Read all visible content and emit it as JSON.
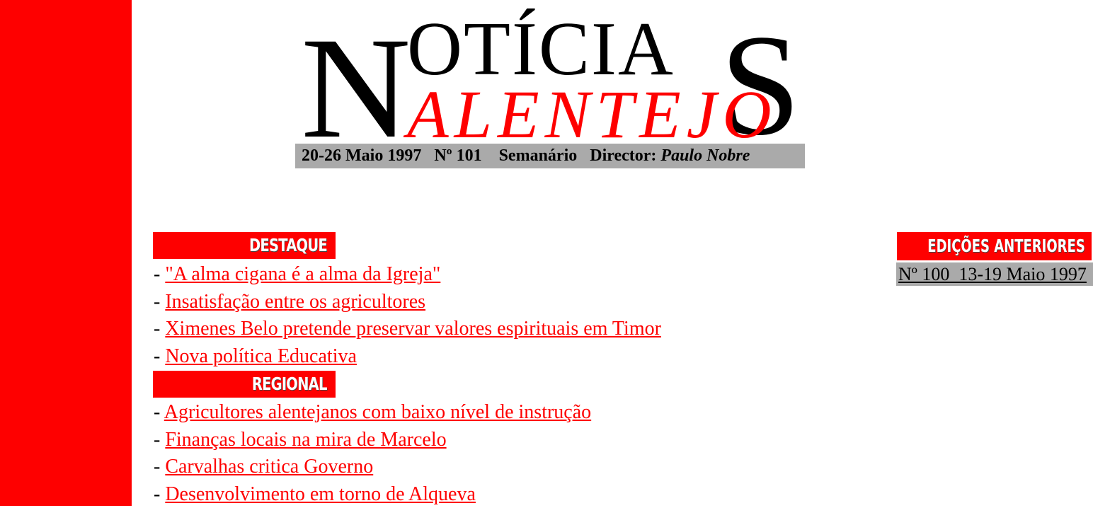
{
  "masthead": {
    "logo_n": "N",
    "logo_otici": "OTÍCIA",
    "logo_s": "S",
    "logo_sub": "ALENTEJO",
    "date": "20-26 Maio 1997",
    "number": "Nº 101",
    "type": "Semanário",
    "director_label": "Director:",
    "director_name": "Paulo Nobre"
  },
  "sections": [
    {
      "title": "DESTAQUE",
      "items": [
        "\"A alma cigana é a alma da Igreja\"",
        "Insatisfação entre os agricultores",
        "Ximenes Belo pretende preservar valores espirituais em Timor",
        "Nova política Educativa"
      ]
    },
    {
      "title": "REGIONAL",
      "items": [
        "Agricultores alentejanos com baixo nível de instrução",
        "Finanças locais na mira de Marcelo",
        "Carvalhas critica Governo",
        "Desenvolvimento em torno de Alqueva"
      ]
    }
  ],
  "previous_editions": {
    "title": "EDIÇÕES ANTERIORES",
    "link": "Nº 100  13-19 Maio 1997"
  },
  "colors": {
    "accent": "#fe0000",
    "bar_gray": "#aaaaaa"
  }
}
